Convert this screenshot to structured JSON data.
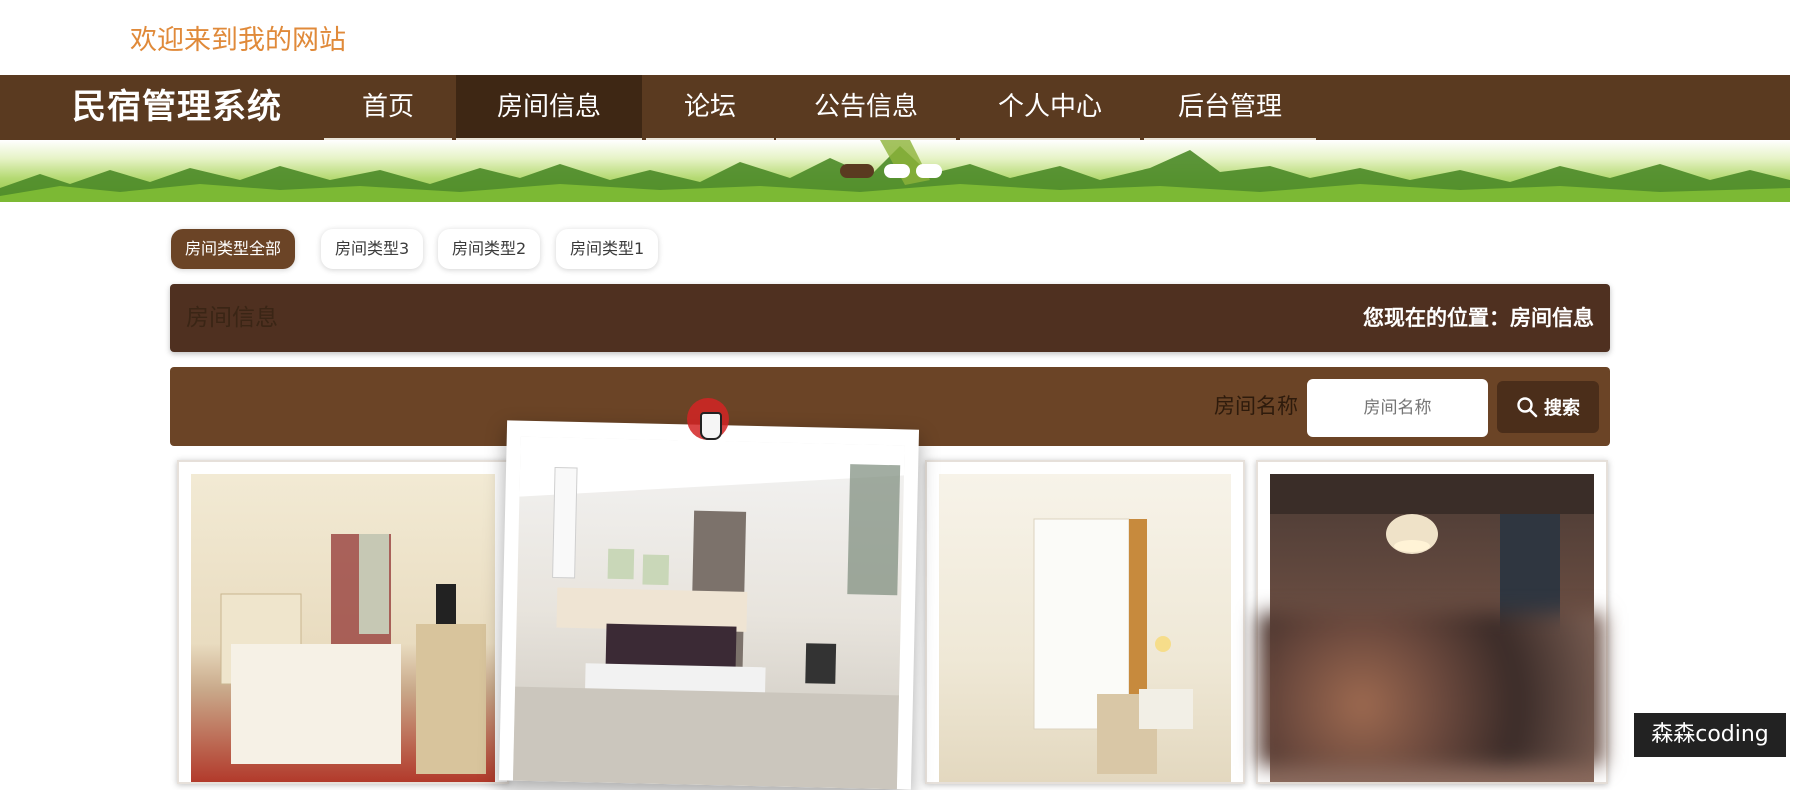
{
  "header": {
    "welcome_text": "欢迎来到我的网站"
  },
  "nav": {
    "brand": "民宿管理系统",
    "items": [
      {
        "label": "首页",
        "active": false
      },
      {
        "label": "房间信息",
        "active": true
      },
      {
        "label": "论坛",
        "active": false
      },
      {
        "label": "公告信息",
        "active": false
      },
      {
        "label": "个人中心",
        "active": false
      },
      {
        "label": "后台管理",
        "active": false
      }
    ]
  },
  "banner": {
    "dot_count": 3,
    "active_dot": 0
  },
  "categories": [
    {
      "label": "房间类型全部",
      "active": true
    },
    {
      "label": "房间类型3",
      "active": false
    },
    {
      "label": "房间类型2",
      "active": false
    },
    {
      "label": "房间类型1",
      "active": false
    }
  ],
  "section": {
    "title": "房间信息",
    "breadcrumb": "您现在的位置：房间信息"
  },
  "search": {
    "label": "房间名称",
    "placeholder": "房间名称",
    "button": "搜索"
  },
  "watermark": "森森coding",
  "colors": {
    "nav_bg": "#5a3a20",
    "nav_active": "#3e2714",
    "accent": "#6b4426",
    "welcome": "#e08a3a"
  }
}
